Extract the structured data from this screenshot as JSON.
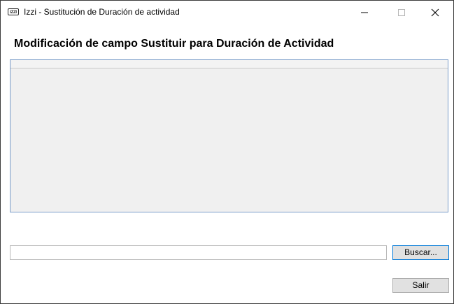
{
  "window": {
    "title": "Izzi - Sustitución de Duración de actividad",
    "icon_label": "IZZI",
    "controls": [
      "minimize-icon",
      "maximize-icon",
      "close-icon"
    ]
  },
  "main": {
    "heading": "Modificación de campo Sustituir para Duración de Actividad"
  },
  "file_input": {
    "value": "",
    "placeholder": ""
  },
  "buttons": {
    "search_label": "Buscar...",
    "exit_label": "Salir"
  },
  "colors": {
    "grid_border": "#7a9cc9",
    "grid_background": "#f0f0f0",
    "focused_button_border": "#0078d7",
    "button_face": "#e1e1e1"
  }
}
